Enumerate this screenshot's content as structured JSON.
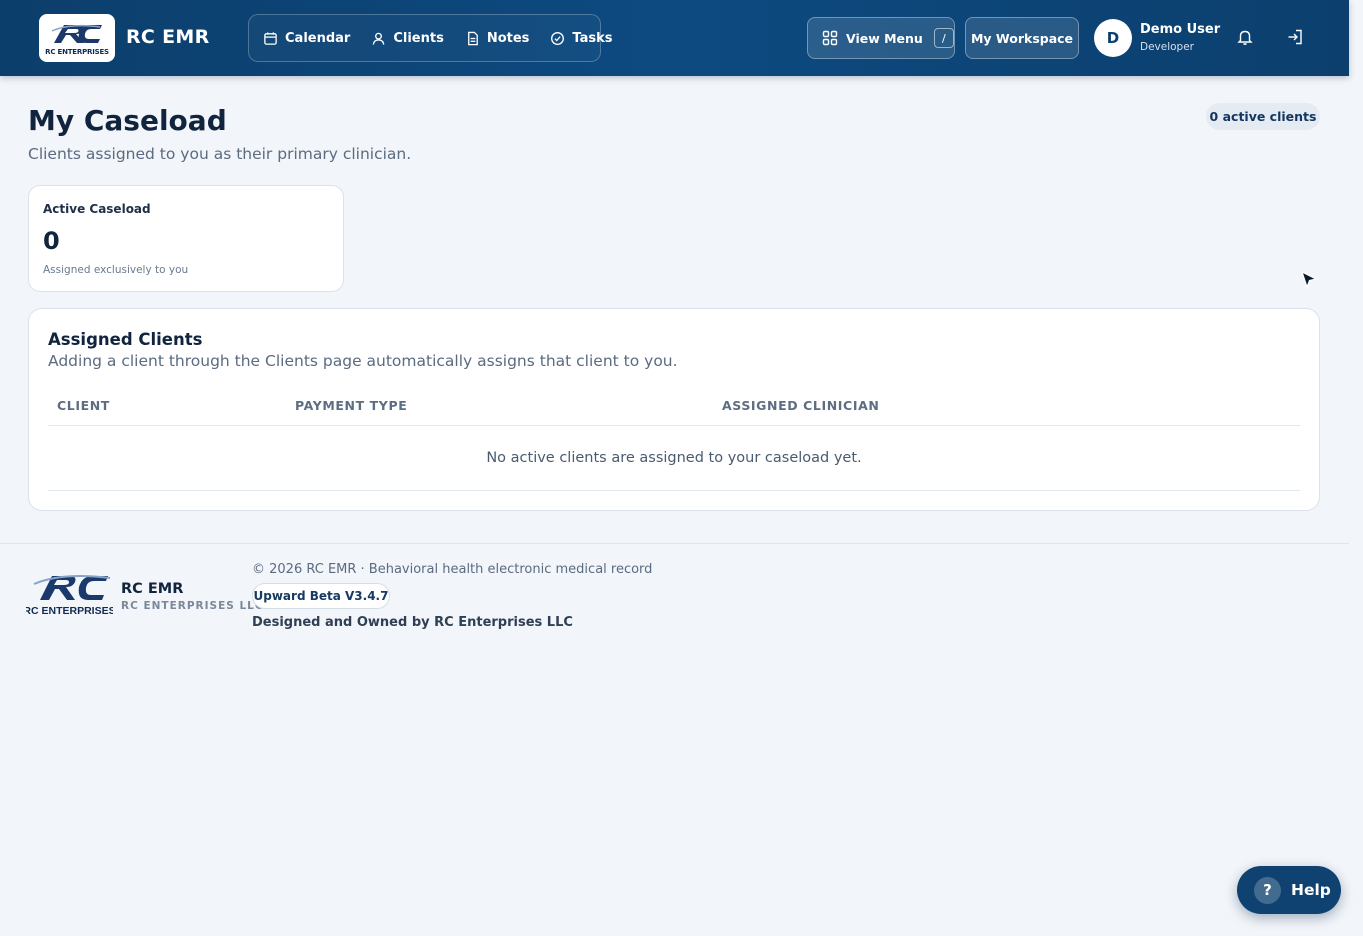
{
  "header": {
    "logo_text": "RC ENTERPRISES",
    "brand": "RC EMR",
    "nav": [
      {
        "label": "Calendar",
        "icon": "calendar-icon"
      },
      {
        "label": "Clients",
        "icon": "user-icon"
      },
      {
        "label": "Notes",
        "icon": "document-icon"
      },
      {
        "label": "Tasks",
        "icon": "check-circle-icon"
      }
    ],
    "view_menu_label": "View Menu",
    "view_menu_shortcut": "/",
    "workspace_label": "My Workspace",
    "user": {
      "initial": "D",
      "name": "Demo User",
      "role": "Developer"
    },
    "icons": [
      "grid-icon",
      "bell-icon",
      "sign-out-icon"
    ]
  },
  "main": {
    "title": "My Caseload",
    "subtitle": "Clients assigned to you as their primary clinician.",
    "count_badge": "0 active clients",
    "stat": {
      "label": "Active Caseload",
      "value": "0",
      "note": "Assigned exclusively to you"
    },
    "panel": {
      "title": "Assigned Clients",
      "subtitle": "Adding a client through the Clients page automatically assigns that client to you.",
      "columns": [
        "CLIENT",
        "PAYMENT TYPE",
        "ASSIGNED CLINICIAN"
      ],
      "empty_message": "No active clients are assigned to your caseload yet."
    }
  },
  "footer": {
    "brand": "RC EMR",
    "company": "RC ENTERPRISES LLC",
    "logo_text": "RC ENTERPRISES",
    "copyright": "© 2026 RC EMR · Behavioral health electronic medical record",
    "version": "Upward Beta V3.4.7",
    "owner": "Designed and Owned by RC Enterprises LLC"
  },
  "help": {
    "label": "Help",
    "icon_text": "?"
  },
  "colors": {
    "header": "#0d4a80",
    "background": "#f2f5f9",
    "text": "#10243e",
    "accent": "#0f4271"
  }
}
